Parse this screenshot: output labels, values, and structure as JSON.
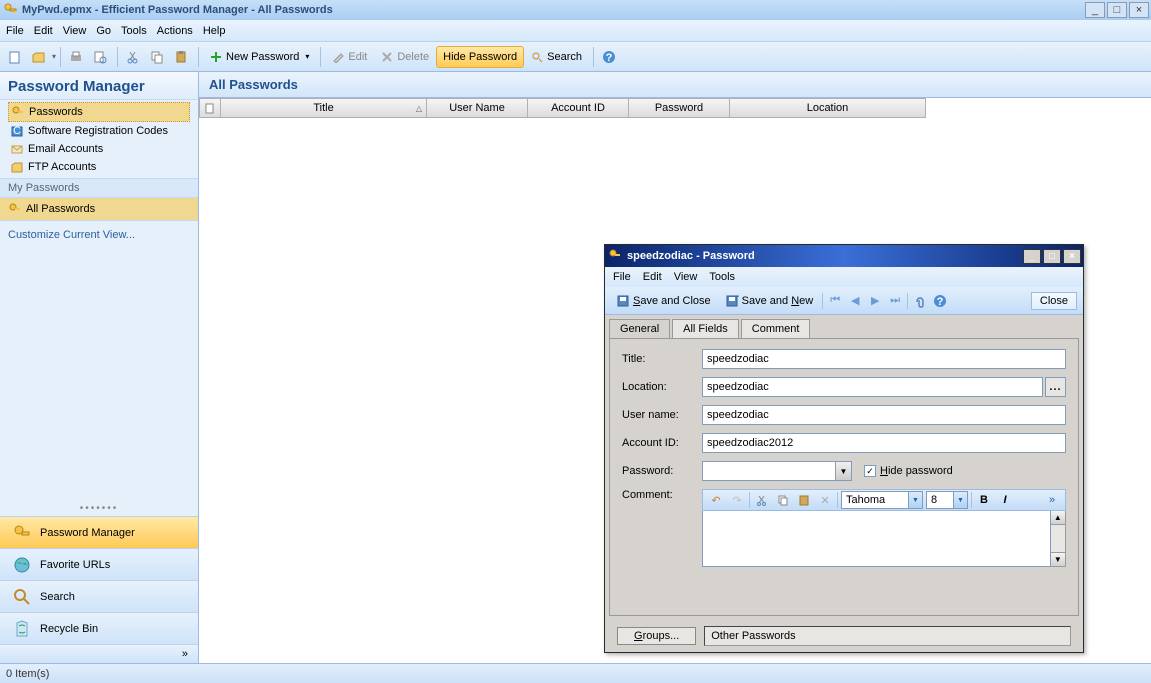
{
  "window": {
    "title": "MyPwd.epmx - Efficient Password Manager - All Passwords",
    "min": "_",
    "max": "□",
    "close": "×"
  },
  "menubar": {
    "items": [
      "File",
      "Edit",
      "View",
      "Go",
      "Tools",
      "Actions",
      "Help"
    ]
  },
  "toolbar": {
    "new_password": "New Password",
    "edit": "Edit",
    "delete": "Delete",
    "hide_password": "Hide Password",
    "search": "Search"
  },
  "sidebar": {
    "title": "Password Manager",
    "tree": [
      {
        "label": "Passwords",
        "icon": "key"
      },
      {
        "label": "Software Registration Codes",
        "icon": "box"
      },
      {
        "label": "Email Accounts",
        "icon": "mail"
      },
      {
        "label": "FTP Accounts",
        "icon": "ftp"
      }
    ],
    "my_passwords_label": "My Passwords",
    "all_passwords_label": "All Passwords",
    "customize_label": "Customize Current View...",
    "nav": [
      {
        "label": "Password Manager"
      },
      {
        "label": "Favorite URLs"
      },
      {
        "label": "Search"
      },
      {
        "label": "Recycle Bin"
      }
    ],
    "chevrons": "»"
  },
  "content": {
    "header": "All Passwords",
    "columns": [
      "",
      "Title",
      "User Name",
      "Account ID",
      "Password",
      "Location"
    ]
  },
  "statusbar": {
    "text": "0 Item(s)"
  },
  "dialog": {
    "title": "speedzodiac - Password",
    "menu": [
      "File",
      "Edit",
      "View",
      "Tools"
    ],
    "save_close": "Save and Close",
    "save_new": "Save and New",
    "close": "Close",
    "tabs": [
      "General",
      "All Fields",
      "Comment"
    ],
    "form": {
      "title_label": "Title:",
      "title_value": "speedzodiac",
      "location_label": "Location:",
      "location_value": "speedzodiac",
      "loc_btn": "...",
      "username_label": "User name:",
      "username_value": "speedzodiac",
      "account_label": "Account ID:",
      "account_value": "speedzodiac2012",
      "password_label": "Password:",
      "password_value": "",
      "hide_cb": "Hide password",
      "comment_label": "Comment:",
      "font_name": "Tahoma",
      "font_size": "8"
    },
    "groups_btn": "Groups...",
    "group_path": "Other Passwords"
  }
}
